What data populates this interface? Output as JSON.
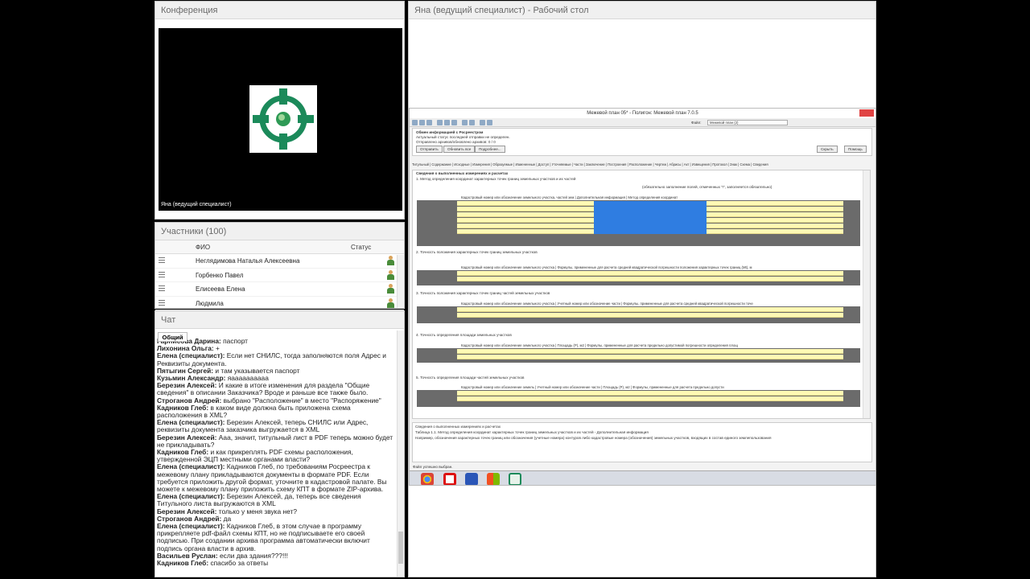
{
  "conference": {
    "title": "Конференция",
    "video_label": "Яна (ведущий специалист)"
  },
  "participants": {
    "title": "Участники (100)",
    "col_name": "ФИО",
    "col_status": "Статус",
    "rows": [
      "Неглядимова Наталья   Алексеевна",
      "Горбенко Павел",
      "Елисеева Елена",
      "Людмила"
    ]
  },
  "chat": {
    "title": "Чат",
    "tab": "Общий",
    "messages": [
      {
        "who": "Гарнисова Дарина:",
        "text": " паспорт"
      },
      {
        "who": "Лихонина Ольга:",
        "text": " +"
      },
      {
        "who": "Елена (специалист):",
        "text": " Если нет СНИЛС, тогда заполняются поля Адрес и Реквизиты документа."
      },
      {
        "who": "Пятыгин Сергей:",
        "text": " и там указывается паспорт"
      },
      {
        "who": "Кузьмин Александр:",
        "text": " яаааааааааа"
      },
      {
        "who": "Березин Алексей:",
        "text": " И какие в итоге изменения для раздела \"Общие сведения\" в описании Заказчика? Вроде и раньше все также было."
      },
      {
        "who": "Строганов Андрей:",
        "text": " выбрано \"Расположение\" в место \"Распоряжение\""
      },
      {
        "who": "Кадников Глеб:",
        "text": " в каком виде должна быть приложена схема расположения в XML?"
      },
      {
        "who": "Елена (специалист):",
        "text": " Березин Алексей, теперь СНИЛС или Адрес, реквизиты документа заказчика выгружается в XML"
      },
      {
        "who": "Березин Алексей:",
        "text": " Ааа, значит, титульный лист в PDF теперь можно будет не прикладывать?"
      },
      {
        "who": "Кадников Глеб:",
        "text": " и как прикреплять PDF схемы расположения, утвержденной ЭЦП местными органами власти?"
      },
      {
        "who": "Елена (специалист):",
        "text": "  Кадников Глеб, по требованиям Росреестра к межевому плану прикладываются документы в формате PDF. Если требуется приложить другой формат, уточните в кадастровой палате. Вы можете к межевому плану приложить схему КПТ в формате ZIP-архива."
      },
      {
        "who": "Елена (специалист):",
        "text": " Березин Алексей, да, теперь все сведения Титульного листа выгружаются в XML"
      },
      {
        "who": "Березин Алексей:",
        "text": " только у меня звука нет?"
      },
      {
        "who": "Строганов Андрей:",
        "text": " да"
      },
      {
        "who": "Елена (специалист):",
        "text": " Кадников Глеб, в этом случае в программу прикрепляете pdf-файл схемы КПТ, но не подписываете его своей подписью. При создании архива программа автоматически включит подпись органа власти в архив."
      },
      {
        "who": "Васильев Руслан:",
        "text": " если два здания???!!!"
      },
      {
        "who": "Кадников Глеб:",
        "text": " спасибо за ответы"
      }
    ]
  },
  "desktop": {
    "title": "Яна (ведущий специалист) - Рабочий стол",
    "app_title": "Межевой план 05* - Полигон: Межевой план 7.0.5",
    "file_field_label": "Файл:",
    "file_field_value": "Межевой план (2)",
    "exchange_title": "Обмен информацией с Росреестром",
    "exchange_status": "Актуальный статус последней отправки не определен.",
    "exchange_count": "Отправлено архивов/обновлено архивов: 0 / 0",
    "btn_send": "Отправить",
    "btn_update": "Обновить все",
    "btn_more": "Подробнее...",
    "btn_hide": "Скрыть",
    "btn_help": "Помощь",
    "tabs": "Титульный | Содержание | Исходные | Измерения | Образуемые | Измененные | Доступ | Уточняемые | Части | Заключение | Построения | Расположение | Чертеж | Абрисы | Акт | Извещения | Протокол | Знак | Схема | Сведения",
    "section_heading": "Сведения о выполненных измерениях и расчетах",
    "s1": "1. Метод определения координат характерных точек границ земельных участков и их частей",
    "s2": "2. Точность положения характерных точек границ земельных участков",
    "s3": "3. Точность положения характерных точек границ частей земельных участков",
    "s4": "4. Точность определения площади земельных участков",
    "s5": "5. Точность определения площади частей земельных участков",
    "t1_head": "Кадастровый номер или обозначение земельного участка, частей зем | Дополнительная информация | Метод определения координат",
    "t2_head": "Кадастровый номер или обозначение земельного участка | Формулы, примененные для расчета средней квадратической погрешности положения характерных точек границ (Mt), м",
    "t3_head": "Кадастровый номер или обозначение земельного участка | Учетный номер или обозначение части | Формулы, примененные для расчета средней квадратической погрешности точе",
    "t4_head": "Кадастровый номер или обозначение земельного участка | Площадь (P), м2 | Формулы, примененные для расчета предельно допустимой погрешности определения площ",
    "t5_head": "Кадастровый номер или обозначение земель | Учетный номер или обозначение части | Площадь (P), м2 | Формулы, примененные для расчета предельно допусти",
    "note_fill": "(обязательно заполнение полей, отмеченных \"!\", заполняется обязательно)",
    "footer_caption": "Сведения о выполненных измерениях и расчетах",
    "footer_line1": "Таблица 1.1. Метод определения координат характерных точек границ земельных участков и их частей - Дополнительная информация",
    "footer_line2": "Например, обозначения характерных точек границ или обозначения (учетные номера) контуров либо кадастровые номера (обозначения) земельных участков, входящих в состав единого землепользования",
    "status_bar": "Файл успешно выбран."
  },
  "colors": {
    "logo_green": "#1b8a5a",
    "row_yellow": "#fff9b4",
    "row_blue": "#2f7de1",
    "table_gray": "#6b6b6b"
  }
}
